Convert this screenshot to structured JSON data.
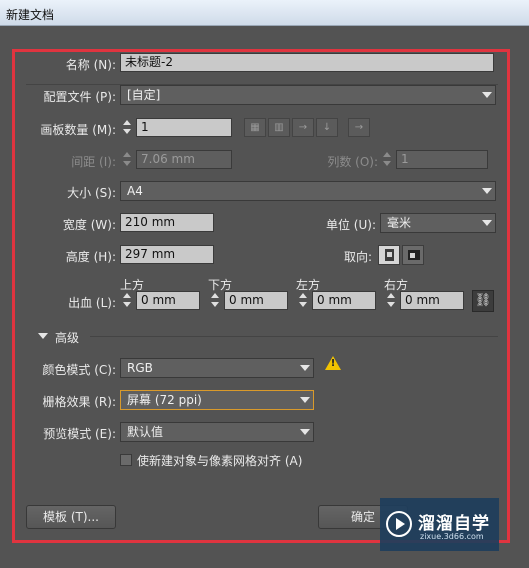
{
  "window": {
    "title": "新建文档"
  },
  "name": {
    "label": "名称 (N):",
    "value": "未标题-2"
  },
  "profile": {
    "label": "配置文件 (P):",
    "value": "[自定]"
  },
  "artboards": {
    "label": "画板数量 (M):",
    "count": "1",
    "arrange_icons": [
      "grid-by-row-icon",
      "grid-by-column-icon",
      "arrange-by-row-icon",
      "arrange-by-column-icon",
      "right-to-left-layout-icon"
    ],
    "spacing_label": "间距 (I):",
    "spacing_value": "7.06 mm",
    "columns_label": "列数 (O):",
    "columns_value": "1"
  },
  "size": {
    "label": "大小 (S):",
    "value": "A4"
  },
  "width": {
    "label": "宽度 (W):",
    "value": "210 mm"
  },
  "units": {
    "label": "单位 (U):",
    "value": "毫米"
  },
  "height": {
    "label": "高度 (H):",
    "value": "297 mm"
  },
  "orientation": {
    "label": "取向:",
    "selected": "portrait"
  },
  "bleed": {
    "label": "出血 (L):",
    "top_label": "上方",
    "top_value": "0 mm",
    "bottom_label": "下方",
    "bottom_value": "0 mm",
    "left_label": "左方",
    "left_value": "0 mm",
    "right_label": "右方",
    "right_value": "0 mm",
    "link_icon": "chain-link-icon"
  },
  "advanced": {
    "label": "高级",
    "color_mode": {
      "label": "颜色模式 (C):",
      "value": "RGB",
      "icon": "warning-icon"
    },
    "raster_effects": {
      "label": "栅格效果 (R):",
      "value": "屏幕 (72 ppi)"
    },
    "preview_mode": {
      "label": "预览模式 (E):",
      "value": "默认值"
    },
    "align_pixel_grid": {
      "label": "使新建对象与像素网格对齐 (A)",
      "checked": false
    }
  },
  "buttons": {
    "templates": "模板 (T)...",
    "ok": "确定"
  },
  "watermark": {
    "brand": "溜溜自学",
    "url": "zixue.3d66.com"
  },
  "colors": {
    "highlight": "#e0343f",
    "focus": "#d99a2b",
    "warning": "#f2c300"
  }
}
